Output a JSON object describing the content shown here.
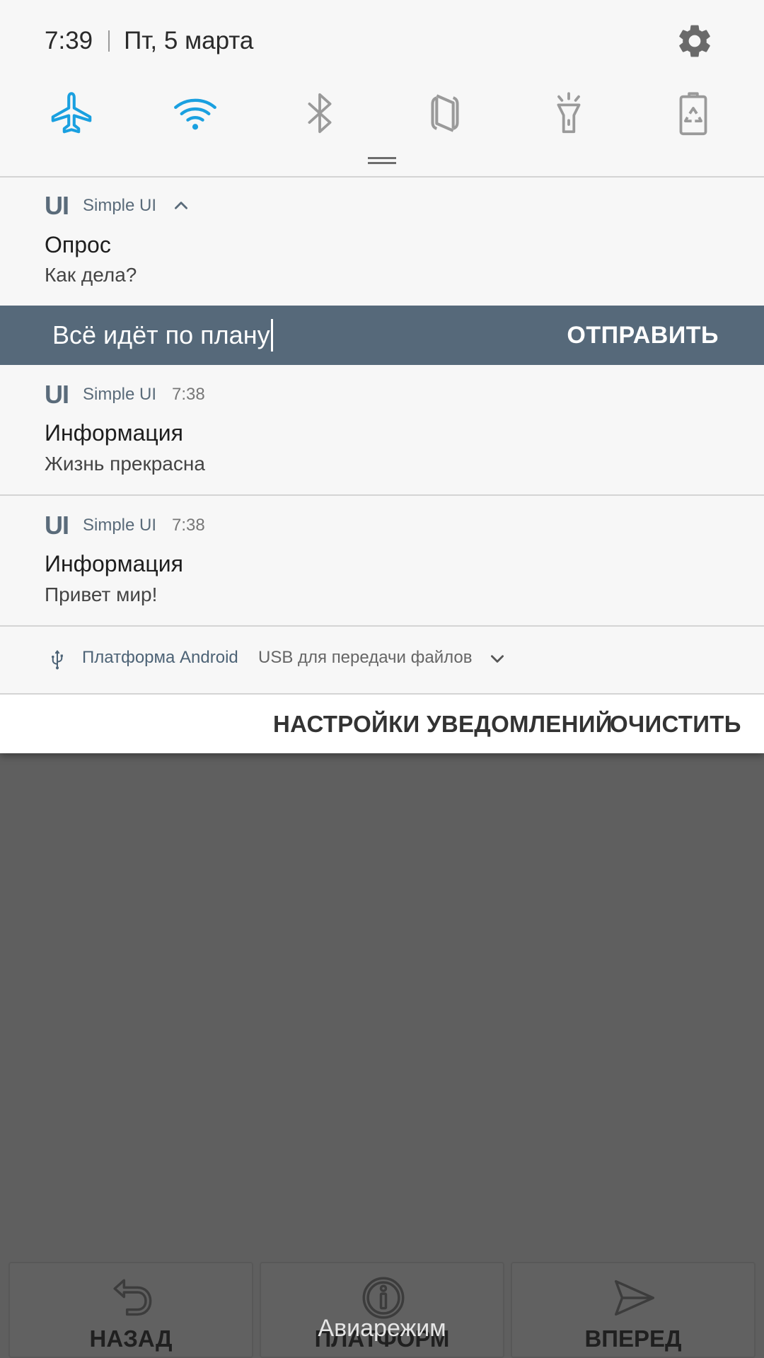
{
  "status": {
    "time": "7:39",
    "date": "Пт, 5 марта"
  },
  "quick_settings": [
    {
      "name": "airplane",
      "icon": "airplane-icon",
      "active": true
    },
    {
      "name": "wifi",
      "icon": "wifi-icon",
      "active": true
    },
    {
      "name": "bluetooth",
      "icon": "bluetooth-icon",
      "active": false
    },
    {
      "name": "nfc",
      "icon": "nfc-icon",
      "active": false
    },
    {
      "name": "flashlight",
      "icon": "flashlight-icon",
      "active": false
    },
    {
      "name": "power-saving",
      "icon": "battery-recycle-icon",
      "active": false
    }
  ],
  "colors": {
    "active": "#1aa0e0",
    "inactive": "#9a9a9a",
    "reply_bar": "#56697a",
    "scrim": "#5f5f5f"
  },
  "notifications": [
    {
      "logo": "UI",
      "app": "Simple UI",
      "time": "",
      "title": "Опрос",
      "text": "Как дела?",
      "expanded": true
    },
    {
      "logo": "UI",
      "app": "Simple UI",
      "time": "7:38",
      "title": "Информация",
      "text": "Жизнь прекрасна"
    },
    {
      "logo": "UI",
      "app": "Simple UI",
      "time": "7:38",
      "title": "Информация",
      "text": "Привет мир!"
    }
  ],
  "reply": {
    "value": "Всё идёт по плану",
    "send_label": "ОТПРАВИТЬ"
  },
  "system_notification": {
    "source": "Платформа Android",
    "message": "USB для передачи файлов"
  },
  "actions": {
    "settings_label": "НАСТРОЙКИ УВЕДОМЛЕНИЙ",
    "clear_label": "ОЧИСТИТЬ"
  },
  "bottom_nav": {
    "back_label": "НАЗАД",
    "middle_label": "ПЛАТФОРМ",
    "forward_label": "ВПЕРЕД"
  },
  "toast": "Авиарежим"
}
